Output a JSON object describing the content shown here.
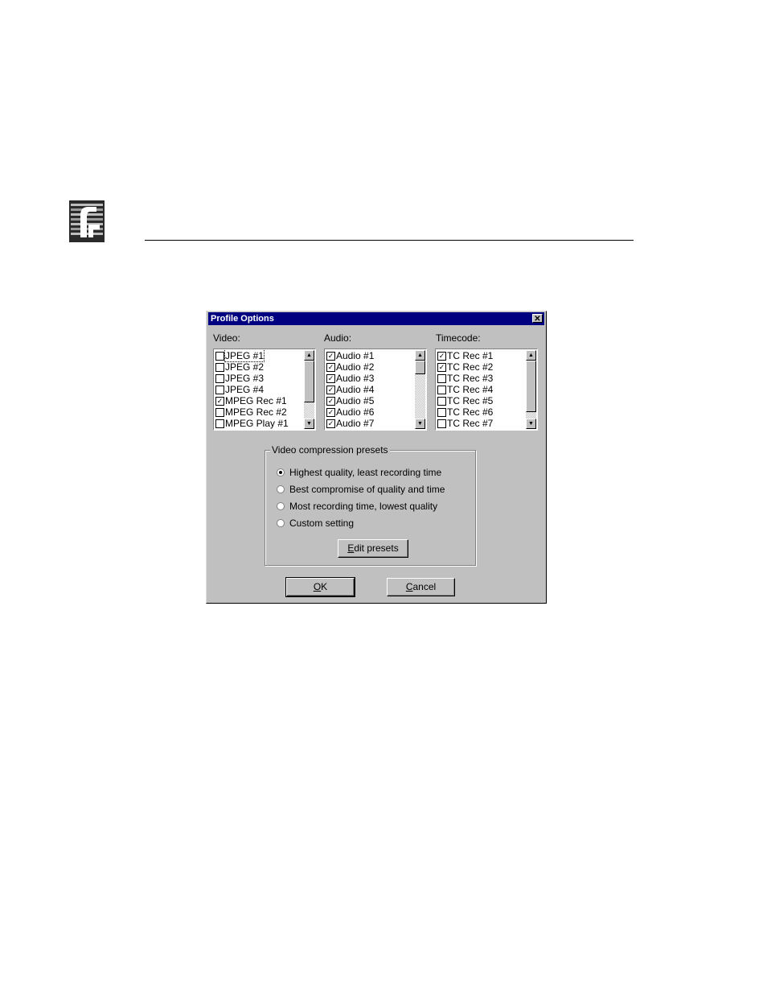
{
  "dialog": {
    "title": "Profile Options",
    "close_label": "✕",
    "columns": {
      "video": {
        "label": "Video:",
        "items": [
          {
            "label": "JPEG #1",
            "checked": false
          },
          {
            "label": "JPEG #2",
            "checked": false
          },
          {
            "label": "JPEG #3",
            "checked": false
          },
          {
            "label": "JPEG #4",
            "checked": false
          },
          {
            "label": "MPEG Rec #1",
            "checked": true
          },
          {
            "label": "MPEG Rec #2",
            "checked": false
          },
          {
            "label": "MPEG Play #1",
            "checked": false
          }
        ]
      },
      "audio": {
        "label": "Audio:",
        "items": [
          {
            "label": "Audio #1",
            "checked": true
          },
          {
            "label": "Audio #2",
            "checked": true
          },
          {
            "label": "Audio #3",
            "checked": true
          },
          {
            "label": "Audio #4",
            "checked": true
          },
          {
            "label": "Audio #5",
            "checked": true
          },
          {
            "label": "Audio #6",
            "checked": true
          },
          {
            "label": "Audio #7",
            "checked": true
          }
        ]
      },
      "timecode": {
        "label": "Timecode:",
        "items": [
          {
            "label": "TC Rec #1",
            "checked": true
          },
          {
            "label": "TC Rec #2",
            "checked": true
          },
          {
            "label": "TC Rec #3",
            "checked": false
          },
          {
            "label": "TC Rec #4",
            "checked": false
          },
          {
            "label": "TC Rec #5",
            "checked": false
          },
          {
            "label": "TC Rec #6",
            "checked": false
          },
          {
            "label": "TC Rec #7",
            "checked": false
          }
        ]
      }
    },
    "presets": {
      "group_title": "Video compression presets",
      "options": [
        {
          "label": "Highest quality, least recording time",
          "selected": true
        },
        {
          "label": "Best compromise of quality and time",
          "selected": false
        },
        {
          "label": "Most recording time, lowest quality",
          "selected": false
        },
        {
          "label": "Custom setting",
          "selected": false
        }
      ],
      "edit_button": {
        "mnemonic": "E",
        "rest": "dit presets"
      }
    },
    "ok_button": {
      "mnemonic": "O",
      "rest": "K"
    },
    "cancel_button": {
      "mnemonic": "C",
      "rest": "ancel"
    }
  },
  "check_glyph": "✓"
}
